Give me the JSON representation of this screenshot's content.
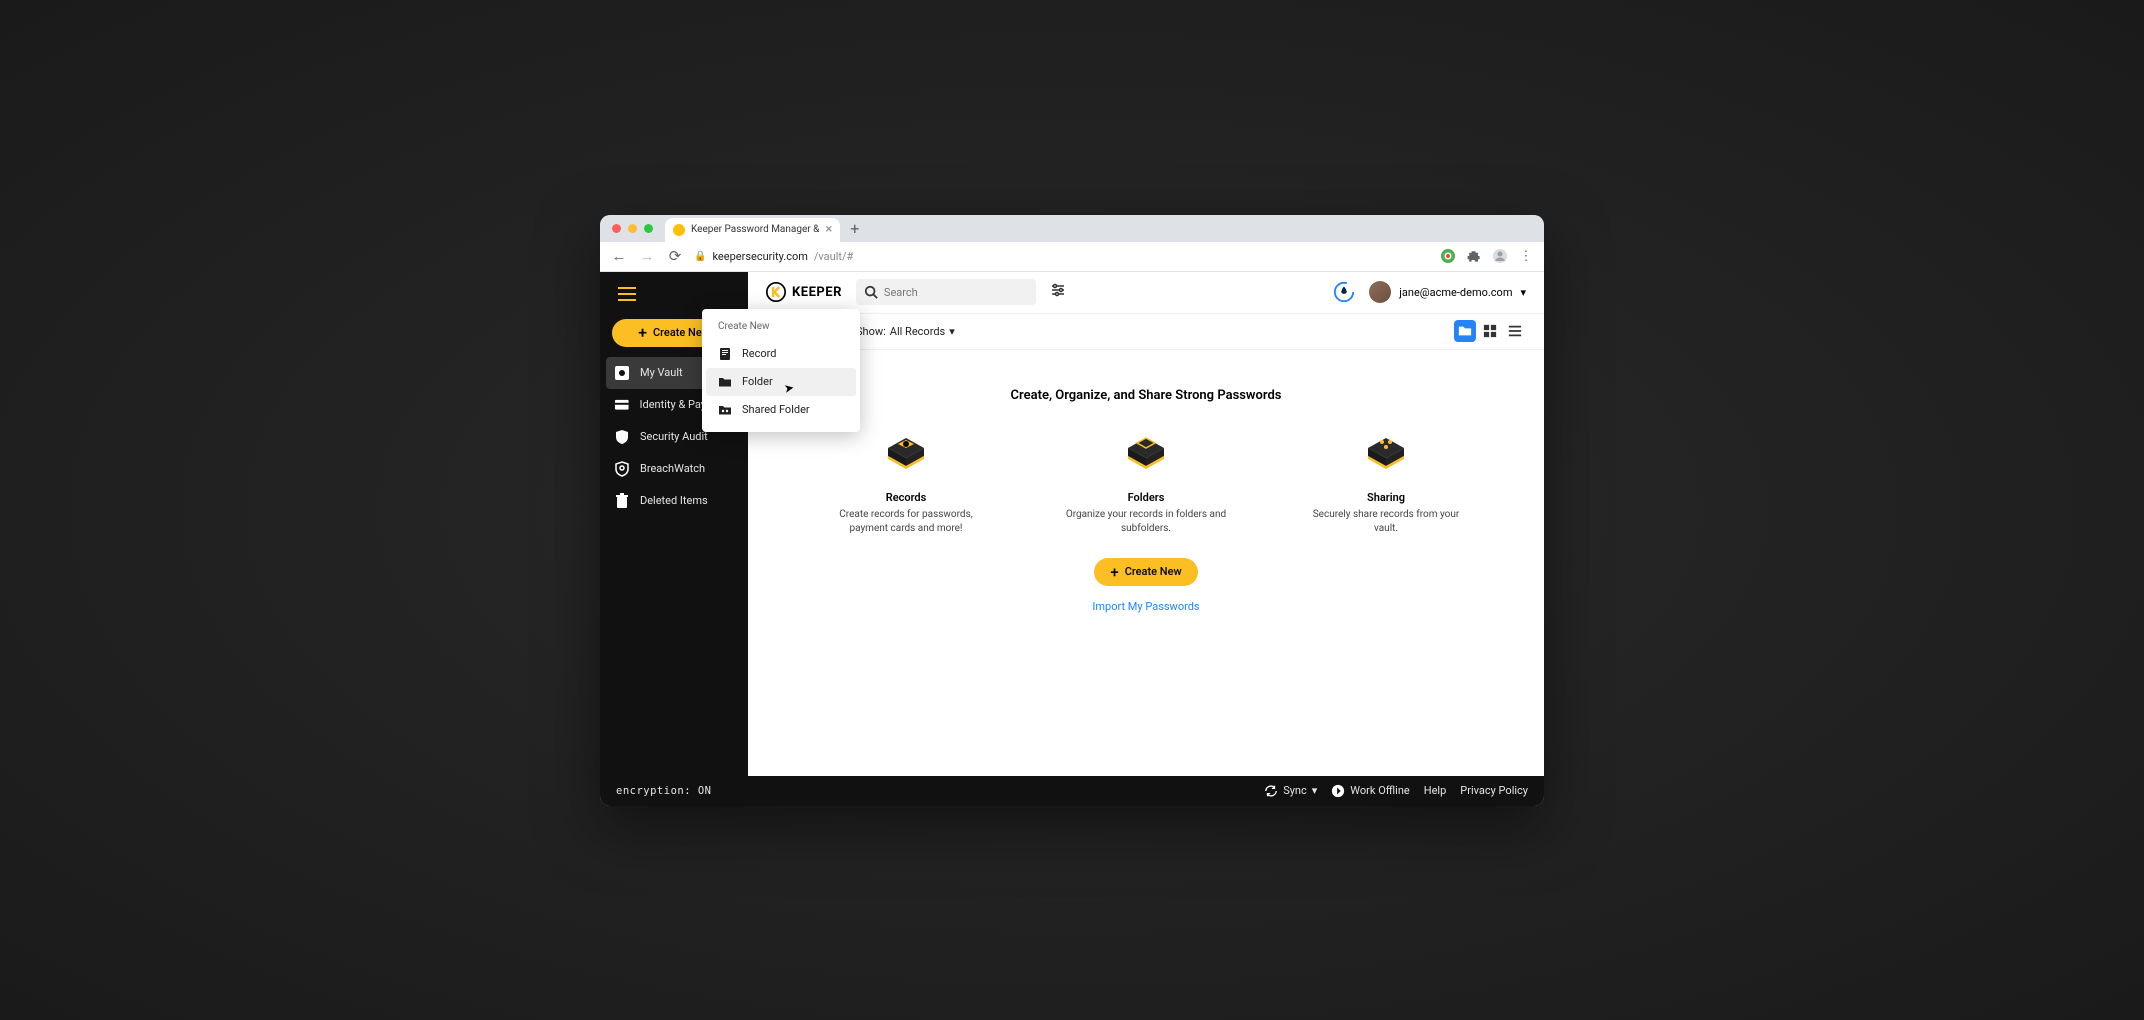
{
  "browser": {
    "tab_title": "Keeper Password Manager &",
    "url_host": "keepersecurity.com",
    "url_path": "/vault/#"
  },
  "sidebar": {
    "create_label": "Create New",
    "items": [
      {
        "label": "My Vault"
      },
      {
        "label": "Identity & Payments"
      },
      {
        "label": "Security Audit"
      },
      {
        "label": "BreachWatch"
      },
      {
        "label": "Deleted Items"
      }
    ]
  },
  "header": {
    "brand": "KEEPER",
    "search_placeholder": "Search",
    "user_email": "jane@acme-demo.com"
  },
  "contentbar": {
    "show_label": "Show:",
    "show_value": "All Records"
  },
  "empty": {
    "title": "Create, Organize, and Share Strong Passwords",
    "cards": [
      {
        "name": "Records",
        "desc": "Create records for passwords, payment cards and more!"
      },
      {
        "name": "Folders",
        "desc": "Organize your records in folders and subfolders."
      },
      {
        "name": "Sharing",
        "desc": "Securely share records from your vault."
      }
    ],
    "create_label": "Create New",
    "import_label": "Import My Passwords"
  },
  "dropdown": {
    "title": "Create New",
    "items": [
      {
        "label": "Record"
      },
      {
        "label": "Folder"
      },
      {
        "label": "Shared Folder"
      }
    ]
  },
  "footer": {
    "encryption": "encryption: ON",
    "sync": "Sync",
    "work_offline": "Work Offline",
    "help": "Help",
    "privacy": "Privacy Policy"
  }
}
